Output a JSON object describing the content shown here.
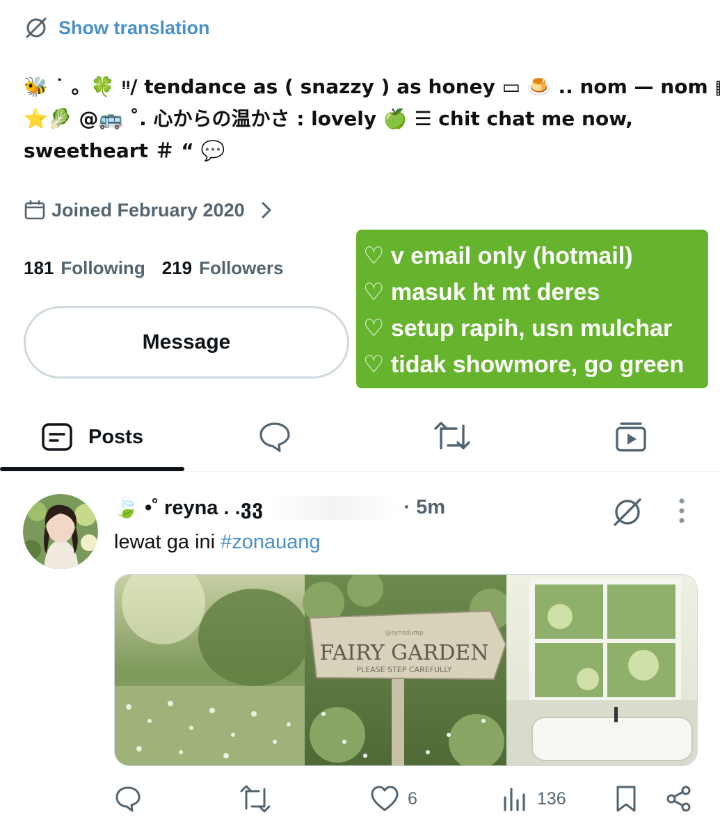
{
  "translate": {
    "label": "Show translation",
    "icon": "no-translate-icon"
  },
  "bio": {
    "line1": "🐝 ˙ 。🍀 ᵎᵎ/ tendance as ( snazzy ) as honey ▭ 🍮 .. nom — nom ▦",
    "line2": "⭐🥬 @🚌 ˚. 心からの温かさ : lovely 🍏 ☰ chit chat me now,",
    "line3": "sweetheart ＃ “ 💬"
  },
  "joined": {
    "label": "Joined February 2020",
    "icon": "calendar-icon"
  },
  "stats": {
    "following_count": "181",
    "following_label": "Following",
    "followers_count": "219",
    "followers_label": "Followers"
  },
  "message_button": {
    "label": "Message"
  },
  "green_note": {
    "lines": [
      "♡ v email only (hotmail)",
      "♡ masuk ht mt deres",
      "♡ setup rapih, usn mulchar",
      "♡ tidak showmore, go green"
    ],
    "color": "#66b32e"
  },
  "tabs": [
    {
      "label": "Posts",
      "icon": "posts-icon",
      "active": true
    },
    {
      "label": "",
      "icon": "replies-icon"
    },
    {
      "label": "",
      "icon": "reposts-icon"
    },
    {
      "label": "",
      "icon": "media-icon"
    }
  ],
  "post": {
    "author": "🍃 •˚ reyna . .ვვ",
    "time": "· 5m",
    "text": "lewat ga ini ",
    "hashtag": "#zonauang",
    "image_sign": {
      "title": "FAIRY GARDEN",
      "subtitle": "PLEASE STEP CAREFULLY",
      "watermark": "@synsdump"
    },
    "actions": {
      "reply_count": "",
      "repost_count": "",
      "like_count": "6",
      "views_count": "136"
    }
  },
  "colors": {
    "link": "#4a90c8",
    "muted": "#536471",
    "text": "#0f1419"
  }
}
